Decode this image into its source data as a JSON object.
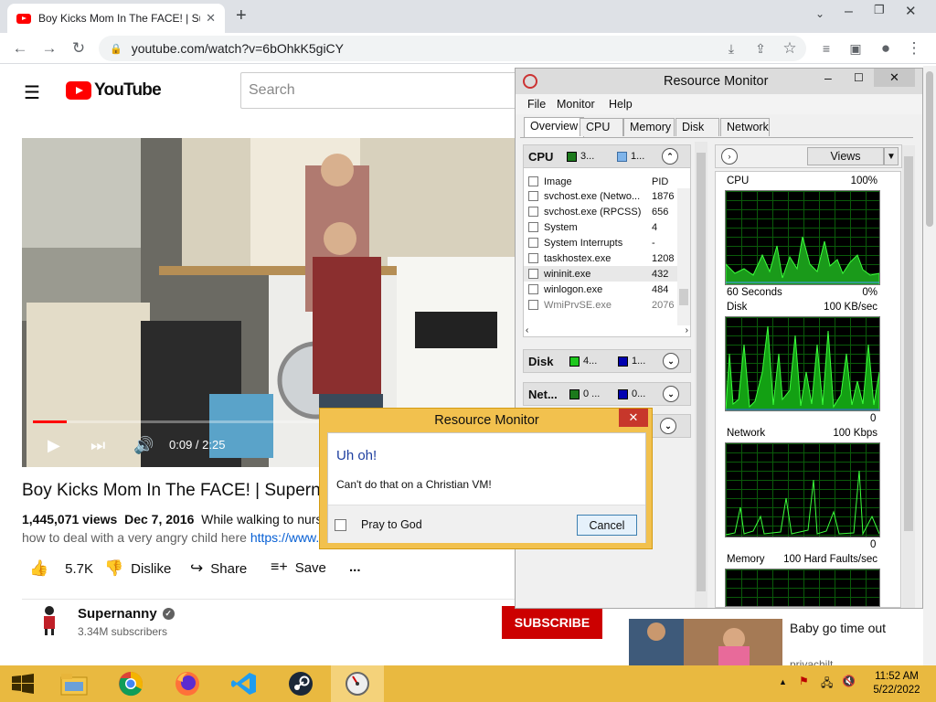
{
  "browser": {
    "tab_title": "Boy Kicks Mom In The FACE! | Su",
    "url": "youtube.com/watch?v=6bOhkK5giCY",
    "new_tab": "+"
  },
  "youtube": {
    "logo_text": "YouTube",
    "search_placeholder": "Search",
    "video_time": "0:09 / 2:25",
    "video_progress_pct": 7,
    "title": "Boy Kicks Mom In The FACE! | Superna",
    "views": "1,445,071 views",
    "date": "Dec 7, 2016",
    "desc_snippet": "While walking to nurse",
    "desc_line2": "how to deal with a very angry child here",
    "desc_link": "https://www.",
    "like_count": "5.7K",
    "dislike_label": "Dislike",
    "share_label": "Share",
    "save_label": "Save",
    "more_label": "...",
    "channel_name": "Supernanny",
    "subscribers": "3.34M subscribers",
    "subscribe_label": "SUBSCRIBE",
    "related_title": "Baby go time out",
    "related_channel": "privachilt"
  },
  "resmon": {
    "title": "Resource Monitor",
    "menu": [
      "File",
      "Monitor",
      "Help"
    ],
    "tabs": [
      "Overview",
      "CPU",
      "Memory",
      "Disk",
      "Network"
    ],
    "cpu_section": "CPU",
    "cpu_stat1": "3...",
    "cpu_stat2": "1...",
    "col_image": "Image",
    "col_pid": "PID",
    "processes": [
      {
        "name": "svchost.exe (Netwo...",
        "pid": "1876"
      },
      {
        "name": "svchost.exe (RPCSS)",
        "pid": "656"
      },
      {
        "name": "System",
        "pid": "4"
      },
      {
        "name": "System Interrupts",
        "pid": "-"
      },
      {
        "name": "taskhostex.exe",
        "pid": "1208"
      },
      {
        "name": "wininit.exe",
        "pid": "432"
      },
      {
        "name": "winlogon.exe",
        "pid": "484"
      },
      {
        "name": "WmiPrvSE.exe",
        "pid": "2076"
      }
    ],
    "disk_section": "Disk",
    "disk_stat1": "4...",
    "disk_stat2": "1...",
    "net_section": "Net...",
    "net_stat1": "0 ...",
    "net_stat2": "0...",
    "views_label": "Views",
    "graphs": {
      "cpu_label": "CPU",
      "cpu_max": "100%",
      "cpu_time": "60 Seconds",
      "cpu_min": "0%",
      "disk_label": "Disk",
      "disk_max": "100 KB/sec",
      "disk_min": "0",
      "net_label": "Network",
      "net_max": "100 Kbps",
      "net_min": "0",
      "mem_label": "Memory",
      "mem_max": "100 Hard Faults/sec"
    }
  },
  "dialog": {
    "title": "Resource Monitor",
    "heading": "Uh oh!",
    "message": "Can't do that on a Christian VM!",
    "checkbox_label": "Pray to God",
    "cancel_label": "Cancel",
    "close_label": "✕"
  },
  "taskbar": {
    "time": "11:52 AM",
    "date": "5/22/2022"
  }
}
